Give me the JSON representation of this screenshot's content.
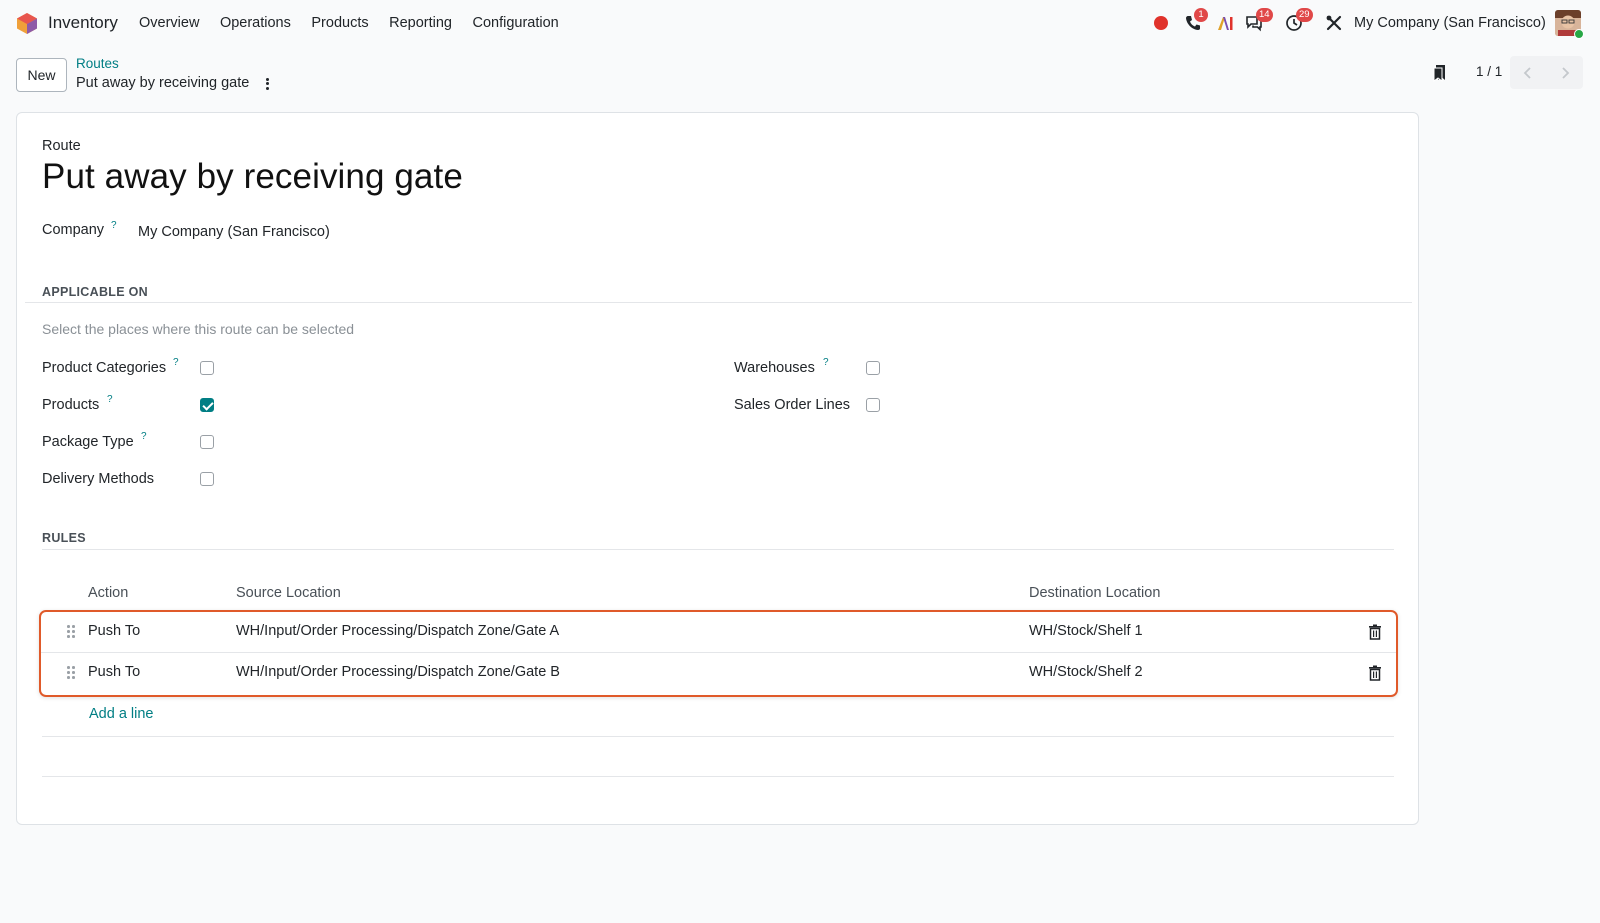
{
  "app": {
    "name": "Inventory"
  },
  "menu": [
    "Overview",
    "Operations",
    "Products",
    "Reporting",
    "Configuration"
  ],
  "systray": {
    "calls_badge": "1",
    "messages_badge": "14",
    "activities_badge": "29",
    "company": "My Company (San Francisco)"
  },
  "control": {
    "new_label": "New",
    "breadcrumb_parent": "Routes",
    "breadcrumb_current": "Put away by receiving gate",
    "pager": "1 / 1"
  },
  "form": {
    "record_label": "Route",
    "title": "Put away by receiving gate",
    "company_label": "Company",
    "company_help": "?",
    "company_value": "My Company (San Francisco)"
  },
  "applicable": {
    "section": "APPLICABLE ON",
    "hint": "Select the places where this route can be selected",
    "left": [
      {
        "label": "Product Categories",
        "help": "?",
        "checked": false
      },
      {
        "label": "Products",
        "help": "?",
        "checked": true
      },
      {
        "label": "Package Type",
        "help": "?",
        "checked": false
      },
      {
        "label": "Delivery Methods",
        "help": "",
        "checked": false
      }
    ],
    "right": [
      {
        "label": "Warehouses",
        "help": "?",
        "checked": false
      },
      {
        "label": "Sales Order Lines",
        "help": "",
        "checked": false
      }
    ]
  },
  "rules": {
    "section": "RULES",
    "headers": {
      "action": "Action",
      "source": "Source Location",
      "destination": "Destination Location"
    },
    "rows": [
      {
        "action": "Push To",
        "source": "WH/Input/Order Processing/Dispatch Zone/Gate A",
        "destination": "WH/Stock/Shelf 1"
      },
      {
        "action": "Push To",
        "source": "WH/Input/Order Processing/Dispatch Zone/Gate B",
        "destination": "WH/Stock/Shelf 2"
      }
    ],
    "add_line": "Add a line"
  },
  "colors": {
    "accent": "#017e84",
    "highlight": "#e05a2a",
    "badge": "#e04848"
  }
}
